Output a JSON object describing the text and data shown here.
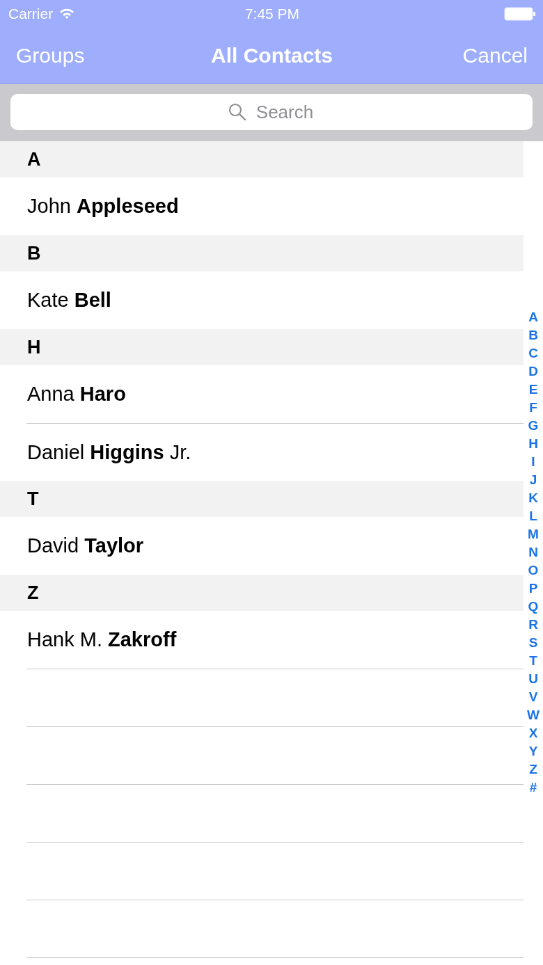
{
  "status_bar": {
    "carrier": "Carrier",
    "time": "7:45 PM"
  },
  "nav_bar": {
    "left_button": "Groups",
    "title": "All Contacts",
    "right_button": "Cancel"
  },
  "search": {
    "placeholder": "Search"
  },
  "sections": [
    {
      "header": "A",
      "contacts": [
        "John **Appleseed**"
      ]
    },
    {
      "header": "B",
      "contacts": [
        "Kate **Bell**"
      ]
    },
    {
      "header": "H",
      "contacts": [
        "Anna **Haro**",
        "Daniel **Higgins** Jr."
      ]
    },
    {
      "header": "T",
      "contacts": [
        "David **Taylor**"
      ]
    },
    {
      "header": "Z",
      "contacts": [
        "Hank M. **Zakroff**"
      ]
    }
  ],
  "section_index": [
    "A",
    "B",
    "C",
    "D",
    "E",
    "F",
    "G",
    "H",
    "I",
    "J",
    "K",
    "L",
    "M",
    "N",
    "O",
    "P",
    "Q",
    "R",
    "S",
    "T",
    "U",
    "V",
    "W",
    "X",
    "Y",
    "Z",
    "#"
  ]
}
